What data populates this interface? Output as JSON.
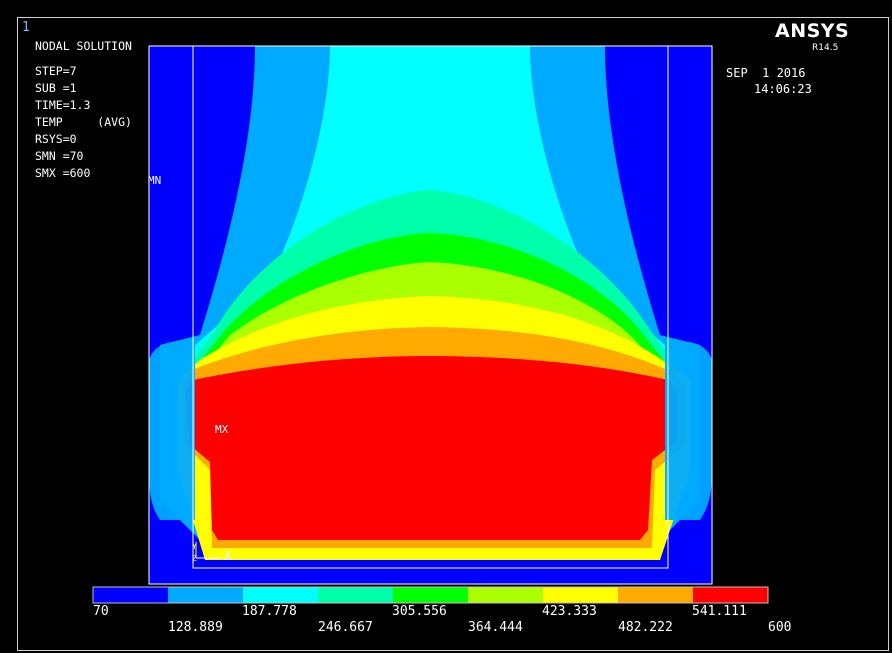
{
  "window": {
    "number": "1"
  },
  "brand": {
    "name": "ANSYS",
    "version": "R14.5"
  },
  "timestamp": {
    "date": "SEP  1 2016",
    "time": "14:06:23"
  },
  "plot": {
    "title": "NODAL SOLUTION",
    "info": [
      "STEP=7",
      "SUB =1",
      "TIME=1.3",
      "TEMP     (AVG)",
      "RSYS=0",
      "SMN =70",
      "SMX =600"
    ],
    "min_marker": "MN",
    "max_marker": "MX",
    "axis_label": "X",
    "axis_label_y": "Y",
    "triad_z": "Z"
  },
  "legend": {
    "colors": [
      "#0000ff",
      "#00aaff",
      "#00ffff",
      "#00ffaa",
      "#00ff00",
      "#aaff00",
      "#ffff00",
      "#ffaa00",
      "#ff0000"
    ],
    "labels_lower": [
      "70",
      "187.778",
      "305.556",
      "423.333",
      "541.111"
    ],
    "labels_upper": [
      "128.889",
      "246.667",
      "364.444",
      "482.222",
      "600"
    ]
  }
}
